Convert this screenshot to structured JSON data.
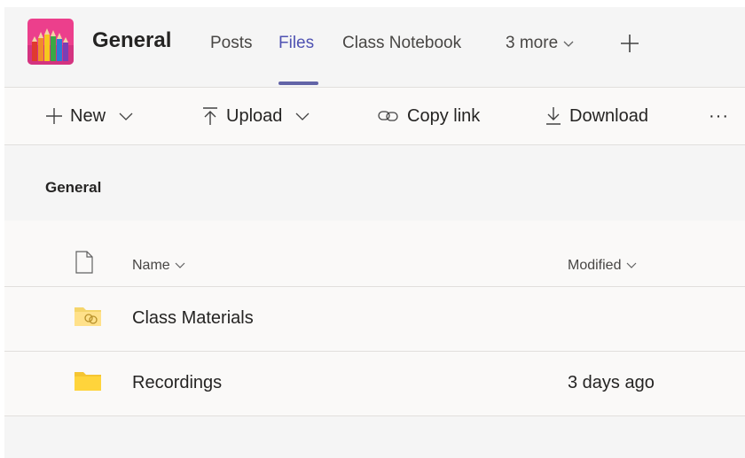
{
  "header": {
    "team_name": "General",
    "tabs": [
      {
        "label": "Posts",
        "active": false
      },
      {
        "label": "Files",
        "active": true
      },
      {
        "label": "Class Notebook",
        "active": false
      },
      {
        "label": "3 more",
        "active": false
      }
    ],
    "add_tab_icon": "plus-icon",
    "accent_color": "#6264a7"
  },
  "toolbar": {
    "new_label": "New",
    "upload_label": "Upload",
    "copy_link_label": "Copy link",
    "download_label": "Download",
    "more_label": "···"
  },
  "breadcrumb": {
    "title": "General"
  },
  "files": {
    "columns": {
      "name": "Name",
      "modified": "Modified"
    },
    "rows": [
      {
        "name": "Class Materials",
        "modified": "",
        "icon": "shared-folder-icon"
      },
      {
        "name": "Recordings",
        "modified": "3 days ago",
        "icon": "folder-icon"
      }
    ]
  }
}
